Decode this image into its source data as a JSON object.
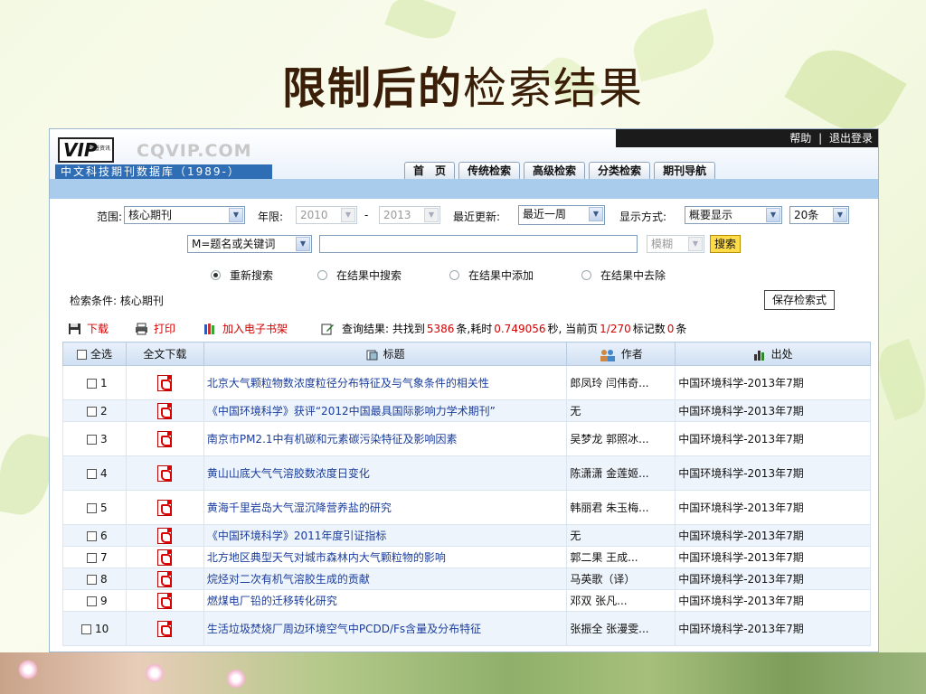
{
  "slide_title_bold": "限制后的",
  "slide_title_rest": "检索结果",
  "topbar": {
    "help": "帮助",
    "sep": "|",
    "logout": "退出登录"
  },
  "logo": {
    "vip": "VIP",
    "vip_sub": "维普资讯",
    "cqvip": "CQVIP.COM",
    "band": "中文科技期刊数据库（1989-）"
  },
  "nav": [
    "首　页",
    "传统检索",
    "高级检索",
    "分类检索",
    "期刊导航"
  ],
  "form": {
    "range_label": "范围:",
    "range_value": "核心期刊",
    "year_label": "年限:",
    "year_from": "2010",
    "year_dash": "-",
    "year_to": "2013",
    "update_label": "最近更新:",
    "update_value": "最近一周",
    "display_label": "显示方式:",
    "display_value": "概要显示",
    "count_value": "20条",
    "field_value": "M=题名或关键词",
    "match_value": "模糊",
    "search_btn": "搜索",
    "radios": [
      "重新搜索",
      "在结果中搜索",
      "在结果中添加",
      "在结果中去除"
    ],
    "condition": "检索条件: 核心期刊",
    "save_btn": "保存检索式"
  },
  "toolbar": {
    "download": "下载",
    "print": "打印",
    "bookshelf": "加入电子书架",
    "result_prefix": "查询结果: 共找到 ",
    "total": "5386",
    "result_mid1": "条,耗时",
    "time": "0.749056",
    "result_mid2": "秒, 当前页",
    "page": "1/270",
    "result_mid3": "标记数",
    "marked": "0",
    "result_suffix": "条"
  },
  "table": {
    "headers": {
      "select_all": "全选",
      "download": "全文下载",
      "title": "标题",
      "author": "作者",
      "source": "出处"
    },
    "rows": [
      {
        "n": "1",
        "title": "北京大气颗粒物数浓度粒径分布特征及与气象条件的相关性",
        "author": "郎凤玲 闫伟奇...",
        "source": "中国环境科学-2013年7期"
      },
      {
        "n": "2",
        "title": "《中国环境科学》获评“2012中国最具国际影响力学术期刊”",
        "author": "无",
        "source": "中国环境科学-2013年7期"
      },
      {
        "n": "3",
        "title": "南京市PM2.1中有机碳和元素碳污染特征及影响因素",
        "author": "吴梦龙 郭照冰...",
        "source": "中国环境科学-2013年7期"
      },
      {
        "n": "4",
        "title": "黄山山底大气气溶胶数浓度日变化",
        "author": "陈潇潇 金莲姬...",
        "source": "中国环境科学-2013年7期"
      },
      {
        "n": "5",
        "title": "黄海千里岩岛大气湿沉降营养盐的研究",
        "author": "韩丽君 朱玉梅...",
        "source": "中国环境科学-2013年7期"
      },
      {
        "n": "6",
        "title": "《中国环境科学》2011年度引证指标",
        "author": "无",
        "source": "中国环境科学-2013年7期"
      },
      {
        "n": "7",
        "title": "北方地区典型天气对城市森林内大气颗粒物的影响",
        "author": "郭二果 王成...",
        "source": "中国环境科学-2013年7期"
      },
      {
        "n": "8",
        "title": "烷烃对二次有机气溶胶生成的贡献",
        "author": "马英歌（译）",
        "source": "中国环境科学-2013年7期"
      },
      {
        "n": "9",
        "title": "燃煤电厂铅的迁移转化研究",
        "author": "邓双 张凡...",
        "source": "中国环境科学-2013年7期"
      },
      {
        "n": "10",
        "title": "生活垃圾焚烧厂周边环境空气中PCDD/Fs含量及分布特征",
        "author": "张振全 张漫雯...",
        "source": "中国环境科学-2013年7期"
      }
    ]
  }
}
